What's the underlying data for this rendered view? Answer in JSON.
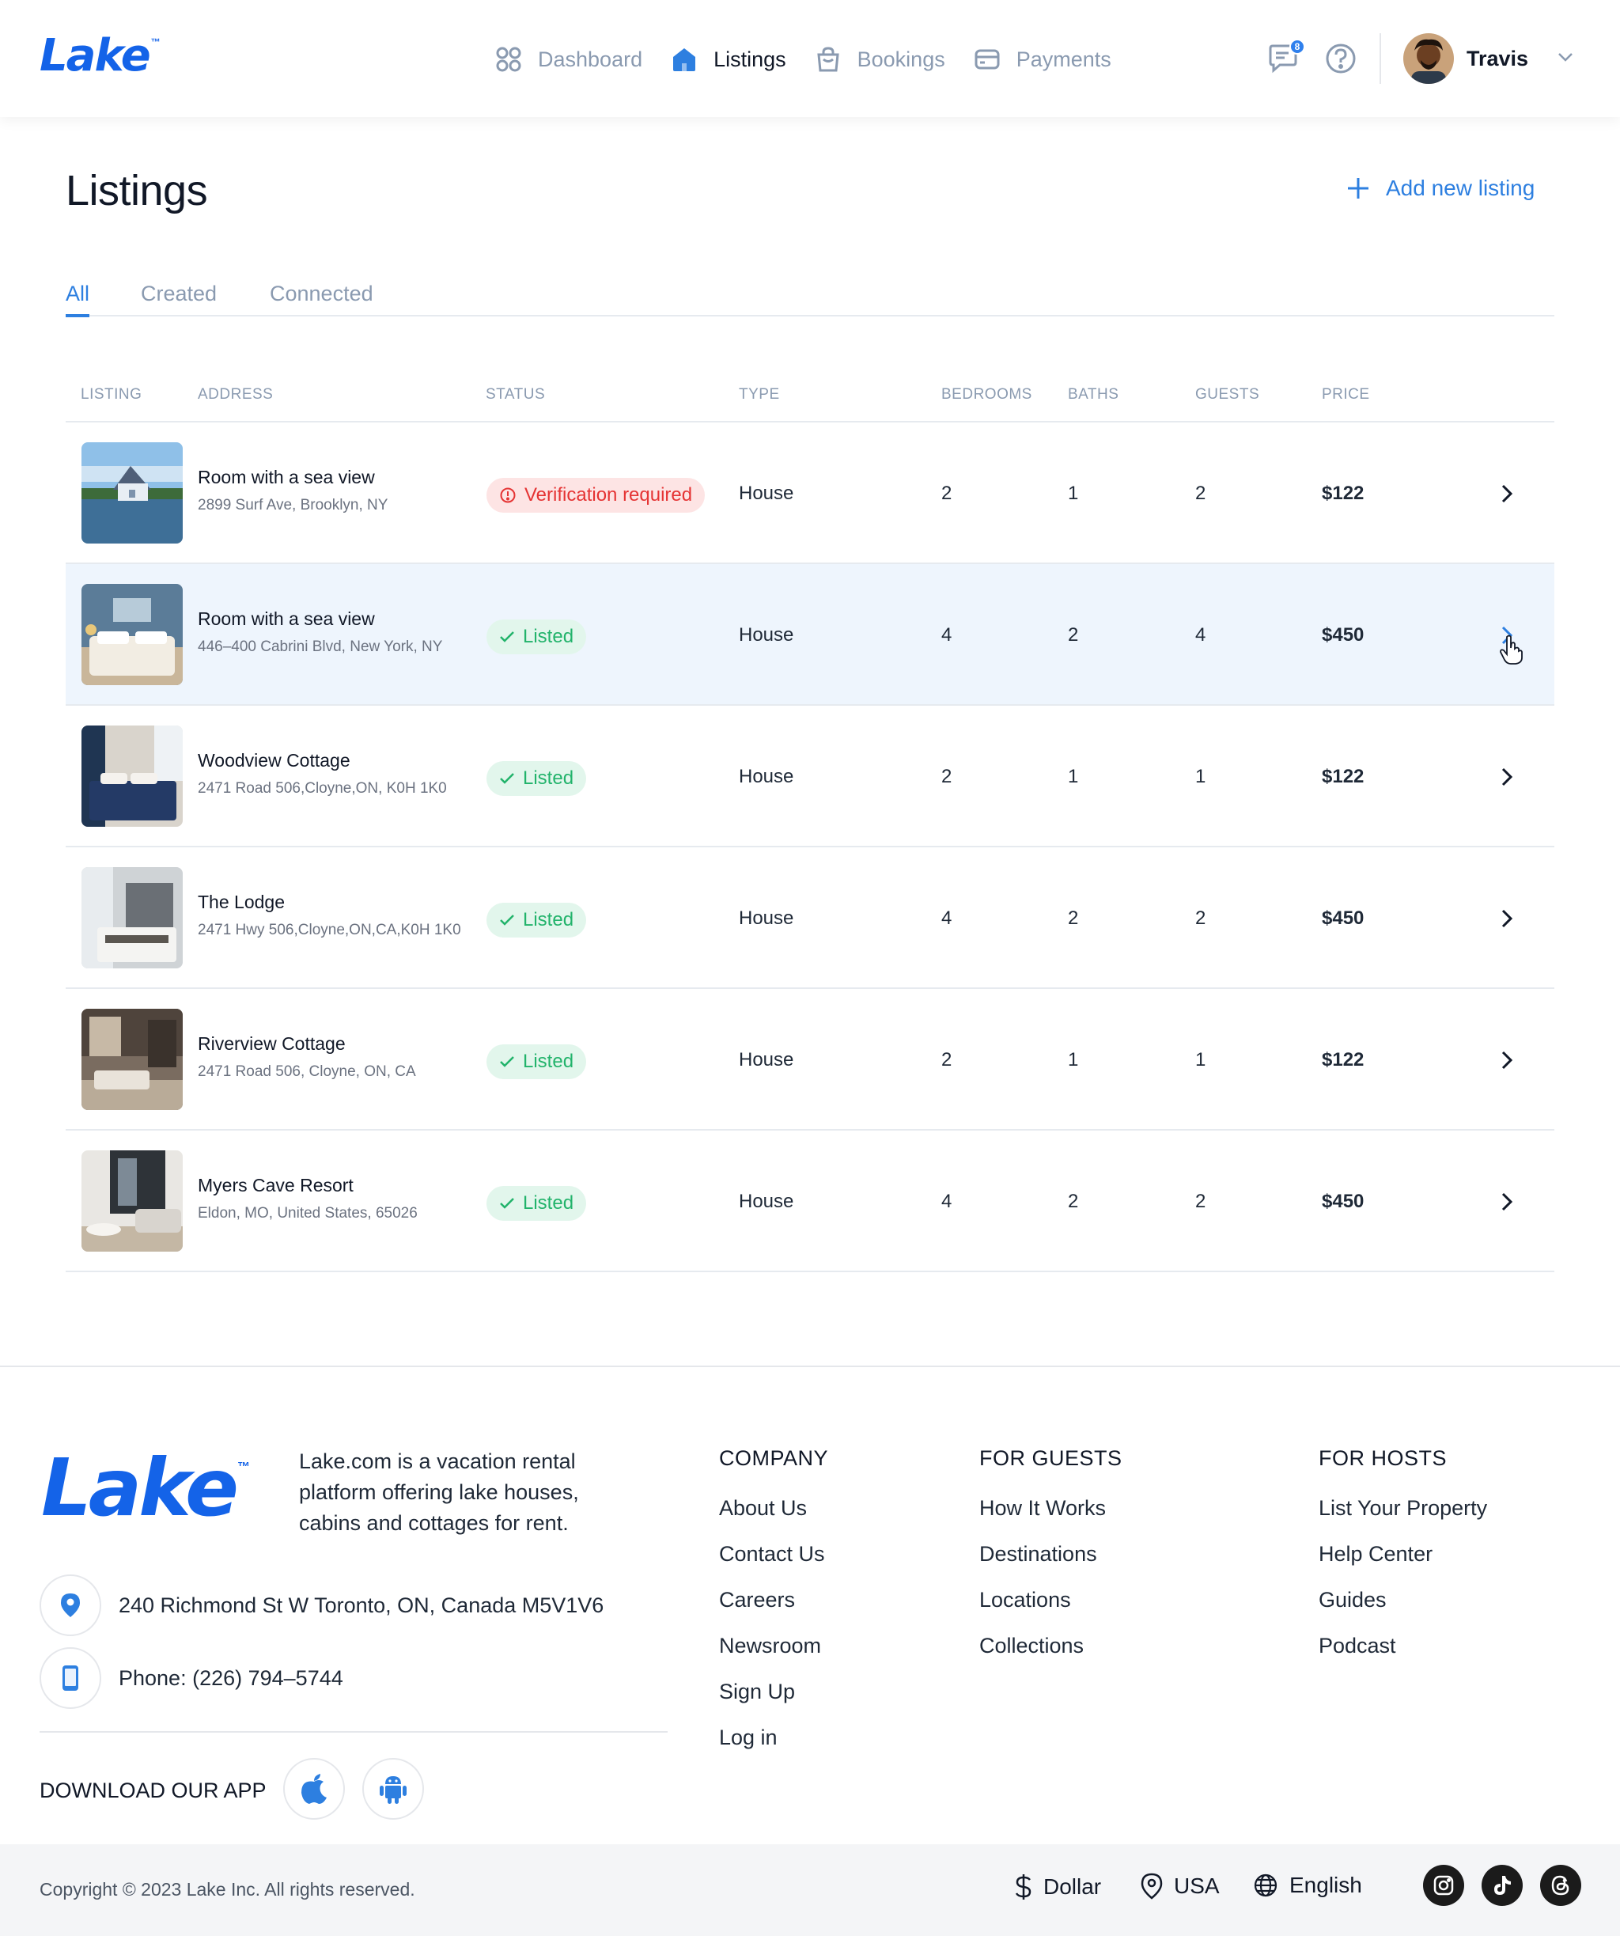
{
  "header": {
    "logo": "Lake",
    "nav": [
      {
        "label": "Dashboard",
        "icon": "grid-icon"
      },
      {
        "label": "Listings",
        "icon": "home-icon"
      },
      {
        "label": "Bookings",
        "icon": "bag-icon"
      },
      {
        "label": "Payments",
        "icon": "card-icon"
      }
    ],
    "active_nav": "Listings",
    "messages_badge": "8",
    "user_name": "Travis"
  },
  "page": {
    "title": "Listings",
    "add_button": "Add new listing",
    "tabs": [
      "All",
      "Created",
      "Connected"
    ],
    "active_tab": "All"
  },
  "table": {
    "columns": [
      "LISTING",
      "ADDRESS",
      "STATUS",
      "TYPE",
      "BEDROOMS",
      "BATHS",
      "GUESTS",
      "PRICE"
    ],
    "rows": [
      {
        "title": "Room with a sea view",
        "address": "2899 Surf Ave, Brooklyn, NY",
        "status": "Verification required",
        "status_kind": "warning",
        "type": "House",
        "bedrooms": "2",
        "baths": "1",
        "guests": "2",
        "price": "$122"
      },
      {
        "title": "Room with a sea view",
        "address": "446–400 Cabrini Blvd, New York, NY",
        "status": "Listed",
        "status_kind": "listed",
        "type": "House",
        "bedrooms": "4",
        "baths": "2",
        "guests": "4",
        "price": "$450"
      },
      {
        "title": "Woodview Cottage",
        "address": "2471 Road 506,Cloyne,ON, K0H 1K0",
        "status": "Listed",
        "status_kind": "listed",
        "type": "House",
        "bedrooms": "2",
        "baths": "1",
        "guests": "1",
        "price": "$122"
      },
      {
        "title": "The Lodge",
        "address": "2471 Hwy 506,Cloyne,ON,CA,K0H 1K0",
        "status": "Listed",
        "status_kind": "listed",
        "type": "House",
        "bedrooms": "4",
        "baths": "2",
        "guests": "2",
        "price": "$450"
      },
      {
        "title": "Riverview Cottage",
        "address": "2471 Road 506, Cloyne, ON, CA",
        "status": "Listed",
        "status_kind": "listed",
        "type": "House",
        "bedrooms": "2",
        "baths": "1",
        "guests": "1",
        "price": "$122"
      },
      {
        "title": "Myers Cave Resort",
        "address": "Eldon, MO, United States, 65026",
        "status": "Listed",
        "status_kind": "listed",
        "type": "House",
        "bedrooms": "4",
        "baths": "2",
        "guests": "2",
        "price": "$450"
      }
    ]
  },
  "footer": {
    "logo": "Lake",
    "description": "Lake.com is a vacation rental platform offering lake houses, cabins and cottages for rent.",
    "address": "240 Richmond St W Toronto, ON, Canada M5V1V6",
    "phone": "Phone: (226) 794–5744",
    "download_label": "DOWNLOAD OUR APP",
    "columns": [
      {
        "heading": "COMPANY",
        "links": [
          "About Us",
          "Contact Us",
          "Careers",
          "Newsroom",
          "Sign Up",
          "Log in"
        ]
      },
      {
        "heading": "FOR GUESTS",
        "links": [
          "How It Works",
          "Destinations",
          "Locations",
          "Collections"
        ]
      },
      {
        "heading": "FOR HOSTS",
        "links": [
          "List Your Property",
          "Help Center",
          "Guides",
          "Podcast"
        ]
      }
    ],
    "copyright": "Copyright © 2023 Lake Inc. All rights reserved.",
    "currency": "Dollar",
    "country": "USA",
    "language": "English"
  },
  "colors": {
    "brand": "#1463e8",
    "accent": "#2d7fe0",
    "listed": "#22b36b",
    "warning": "#e53434",
    "row_hover": "#eef5fd"
  }
}
